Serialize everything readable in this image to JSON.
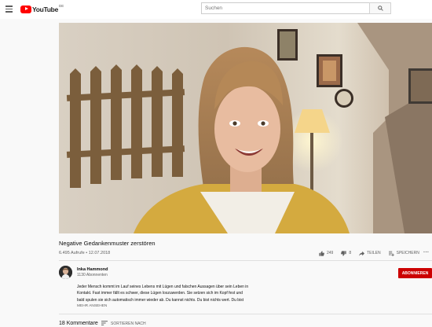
{
  "header": {
    "logo_text": "YouTube",
    "logo_country": "DE",
    "search_placeholder": "Suchen"
  },
  "video": {
    "title": "Negative Gedankenmuster zerstören",
    "views": "6.495 Aufrufe",
    "separator": " • ",
    "date": "12.07.2018",
    "likes": "249",
    "dislikes": "8",
    "share_label": "TEILEN",
    "save_label": "SPEICHERN",
    "more_label": "..."
  },
  "channel": {
    "name": "Inka Hammond",
    "subscribers": "1130 Abonnenten",
    "subscribe_label": "ABONNIEREN"
  },
  "description": {
    "lines": [
      "Jeder Mensch kommt im Lauf seines Lebens mit Lügen und falschen Aussagen über sein Leben in",
      "Kontakt. Fast immer fällt es schwer, diese Lügen loszuwerden. Sie setzen sich im Kopf fest und",
      "bald spulen sie sich automatisch immer wieder ab. Du kannst nichts. Du bist nichts wert. Du bist"
    ],
    "show_more": "MEHR ANSEHEN"
  },
  "comments": {
    "count_label": "18 Kommentare",
    "sort_label": "SORTIEREN NACH"
  },
  "icons": {
    "menu": "menu-icon",
    "search": "search-icon",
    "like": "thumbs-up-icon",
    "dislike": "thumbs-down-icon",
    "share": "share-icon",
    "save": "playlist-add-icon",
    "sort": "sort-icon"
  },
  "colors": {
    "brand_red": "#ff0000",
    "subscribe_bg": "#cc0000",
    "text_secondary": "#606060"
  }
}
